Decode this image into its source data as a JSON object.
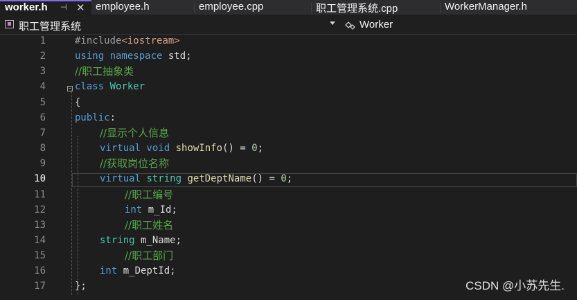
{
  "tabs": [
    {
      "label": "worker.h",
      "active": true
    },
    {
      "label": "employee.h"
    },
    {
      "label": "employee.cpp"
    },
    {
      "label": "职工管理系统.cpp"
    },
    {
      "label": "WorkerManager.h"
    }
  ],
  "navbar": {
    "scope_label": "职工管理系统",
    "member_label": "Worker"
  },
  "editor": {
    "current_line": 10,
    "lines": [
      {
        "num": "1",
        "tokens": [
          {
            "t": "pp",
            "v": "#include"
          },
          {
            "t": "inc",
            "v": "<iostream>"
          }
        ]
      },
      {
        "num": "2",
        "tokens": [
          {
            "t": "kw",
            "v": "using namespace"
          },
          {
            "t": "tx",
            "v": " std;"
          }
        ]
      },
      {
        "num": "3",
        "tokens": [
          {
            "t": "cm",
            "v": "//职工抽象类"
          }
        ]
      },
      {
        "num": "4",
        "tokens": [
          {
            "t": "kw",
            "v": "class"
          },
          {
            "t": "tx",
            "v": " "
          },
          {
            "t": "ty",
            "v": "Worker"
          }
        ]
      },
      {
        "num": "5",
        "tokens": [
          {
            "t": "tx",
            "v": "{"
          }
        ]
      },
      {
        "num": "6",
        "tokens": [
          {
            "t": "kw",
            "v": "public"
          },
          {
            "t": "tx",
            "v": ":"
          }
        ]
      },
      {
        "num": "7",
        "tokens": [
          {
            "t": "cm",
            "v": "//显示个人信息"
          }
        ]
      },
      {
        "num": "8",
        "tokens": [
          {
            "t": "kw",
            "v": "virtual void"
          },
          {
            "t": "tx",
            "v": " "
          },
          {
            "t": "fn",
            "v": "showInfo"
          },
          {
            "t": "tx",
            "v": "() = "
          },
          {
            "t": "nm",
            "v": "0"
          },
          {
            "t": "tx",
            "v": ";"
          }
        ]
      },
      {
        "num": "9",
        "tokens": [
          {
            "t": "cm",
            "v": "//获取岗位名称"
          }
        ]
      },
      {
        "num": "10",
        "tokens": [
          {
            "t": "kw",
            "v": "virtual"
          },
          {
            "t": "tx",
            "v": " "
          },
          {
            "t": "ty",
            "v": "string"
          },
          {
            "t": "tx",
            "v": " "
          },
          {
            "t": "fn",
            "v": "getDeptName"
          },
          {
            "t": "tx",
            "v": "() = "
          },
          {
            "t": "nm",
            "v": "0"
          },
          {
            "t": "tx",
            "v": ";"
          }
        ]
      },
      {
        "num": "11",
        "tokens": [
          {
            "t": "cm",
            "v": "//职工编号"
          }
        ]
      },
      {
        "num": "12",
        "tokens": [
          {
            "t": "kw",
            "v": "int"
          },
          {
            "t": "tx",
            "v": " m_Id;"
          }
        ]
      },
      {
        "num": "13",
        "tokens": [
          {
            "t": "cm",
            "v": "//职工姓名"
          }
        ]
      },
      {
        "num": "14",
        "tokens": [
          {
            "t": "ty",
            "v": "string"
          },
          {
            "t": "tx",
            "v": " m_Name;"
          }
        ]
      },
      {
        "num": "15",
        "tokens": [
          {
            "t": "cm",
            "v": "//职工部门"
          }
        ]
      },
      {
        "num": "16",
        "tokens": [
          {
            "t": "kw",
            "v": "int"
          },
          {
            "t": "tx",
            "v": " m_DeptId;"
          }
        ]
      },
      {
        "num": "17",
        "tokens": [
          {
            "t": "tx",
            "v": "};"
          }
        ]
      }
    ]
  },
  "watermark": "CSDN @小苏先生."
}
